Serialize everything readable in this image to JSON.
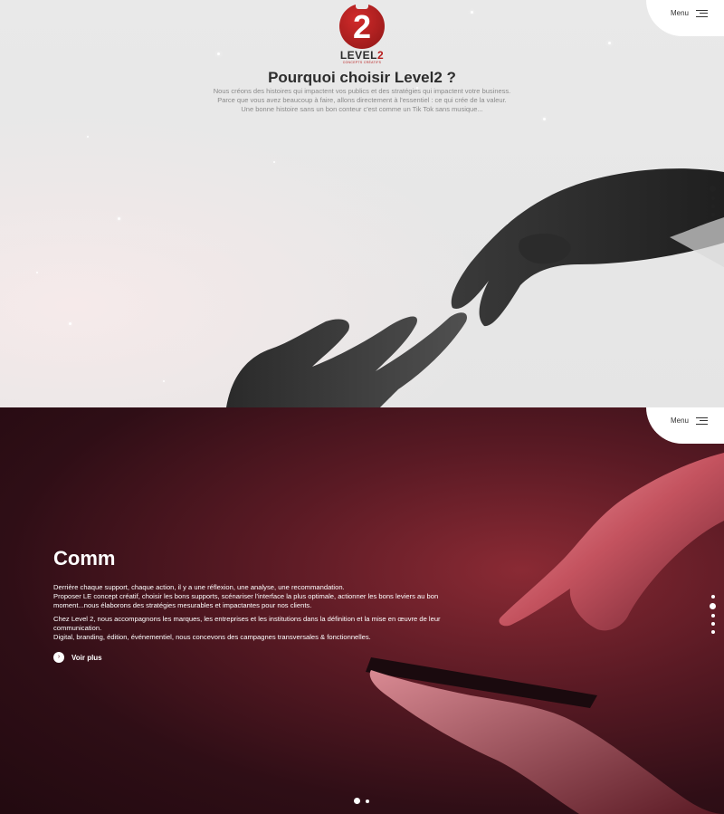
{
  "brand": {
    "logo_number": "2",
    "logo_word_main": "LEVEL",
    "logo_word_accent": "2",
    "logo_tagline": "CONCEPTS CRÉATIFS"
  },
  "menu": {
    "label": "Menu"
  },
  "hero": {
    "title": "Pourquoi choisir Level2 ?",
    "lines": [
      "Nous créons des histoires qui impactent vos publics et des stratégies qui impactent votre business.",
      "Parce que vous avez beaucoup à faire, allons directement à l'essentiel : ce qui crée de la valeur.",
      "Une bonne histoire sans un bon conteur c'est comme un Tik Tok sans musique..."
    ]
  },
  "comm": {
    "title": "Comm",
    "paragraphs": [
      "Derrière chaque support, chaque action, il y a une réflexion, une analyse, une recommandation.",
      "Proposer LE concept créatif, choisir les bons supports, scénariser l'interface la plus optimale, actionner les bons leviers au bon moment...nous élaborons des stratégies mesurables et impactantes pour nos clients.",
      "Chez Level 2, nous accompagnons les marques, les entreprises et les institutions dans la définition et la mise en œuvre de leur communication.",
      "Digital, branding, édition, événementiel, nous concevons des campagnes transversales & fonctionnelles."
    ],
    "cta": "Voir plus",
    "cta_icon": "chevron-right-icon"
  },
  "colors": {
    "brand_red": "#b71c1c",
    "comm_bg": "#5a1a24"
  }
}
